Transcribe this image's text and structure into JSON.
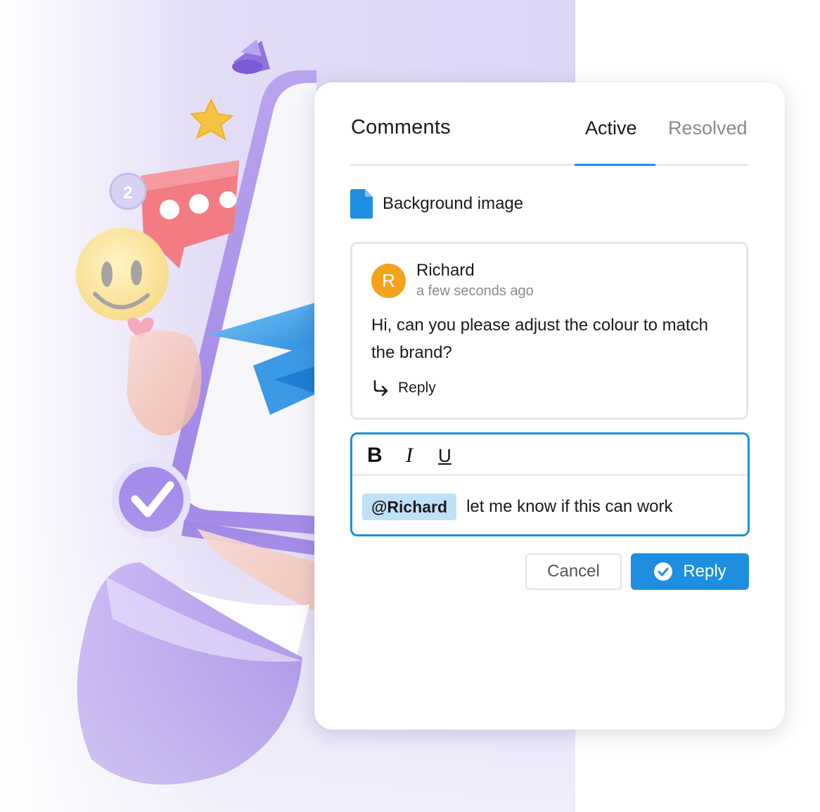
{
  "colors": {
    "accent": "#1e8fe0",
    "avatar": "#f3a41c",
    "mention_bg": "#bfe1f8",
    "background_lavender": "#ddd6f6"
  },
  "illustration": {
    "badge_number": "2",
    "icons": [
      "megaphone",
      "star",
      "chat-bubble",
      "smiley",
      "paper-plane",
      "checkmark",
      "hand-holding-phone"
    ]
  },
  "comments_panel": {
    "title": "Comments",
    "tabs": [
      {
        "label": "Active",
        "active": true
      },
      {
        "label": "Resolved",
        "active": false
      }
    ],
    "file": {
      "icon": "document-icon",
      "name": "Background image"
    },
    "comment": {
      "avatar_initial": "R",
      "author": "Richard",
      "timestamp": "a few seconds ago",
      "text": "Hi, can you please adjust the colour to match the brand?",
      "reply_label": "Reply"
    },
    "editor": {
      "toolbar": {
        "bold": "B",
        "italic": "I",
        "underline": "U"
      },
      "mention": "@Richard",
      "text": "let me know if this can work"
    },
    "actions": {
      "cancel_label": "Cancel",
      "reply_label": "Reply"
    }
  }
}
